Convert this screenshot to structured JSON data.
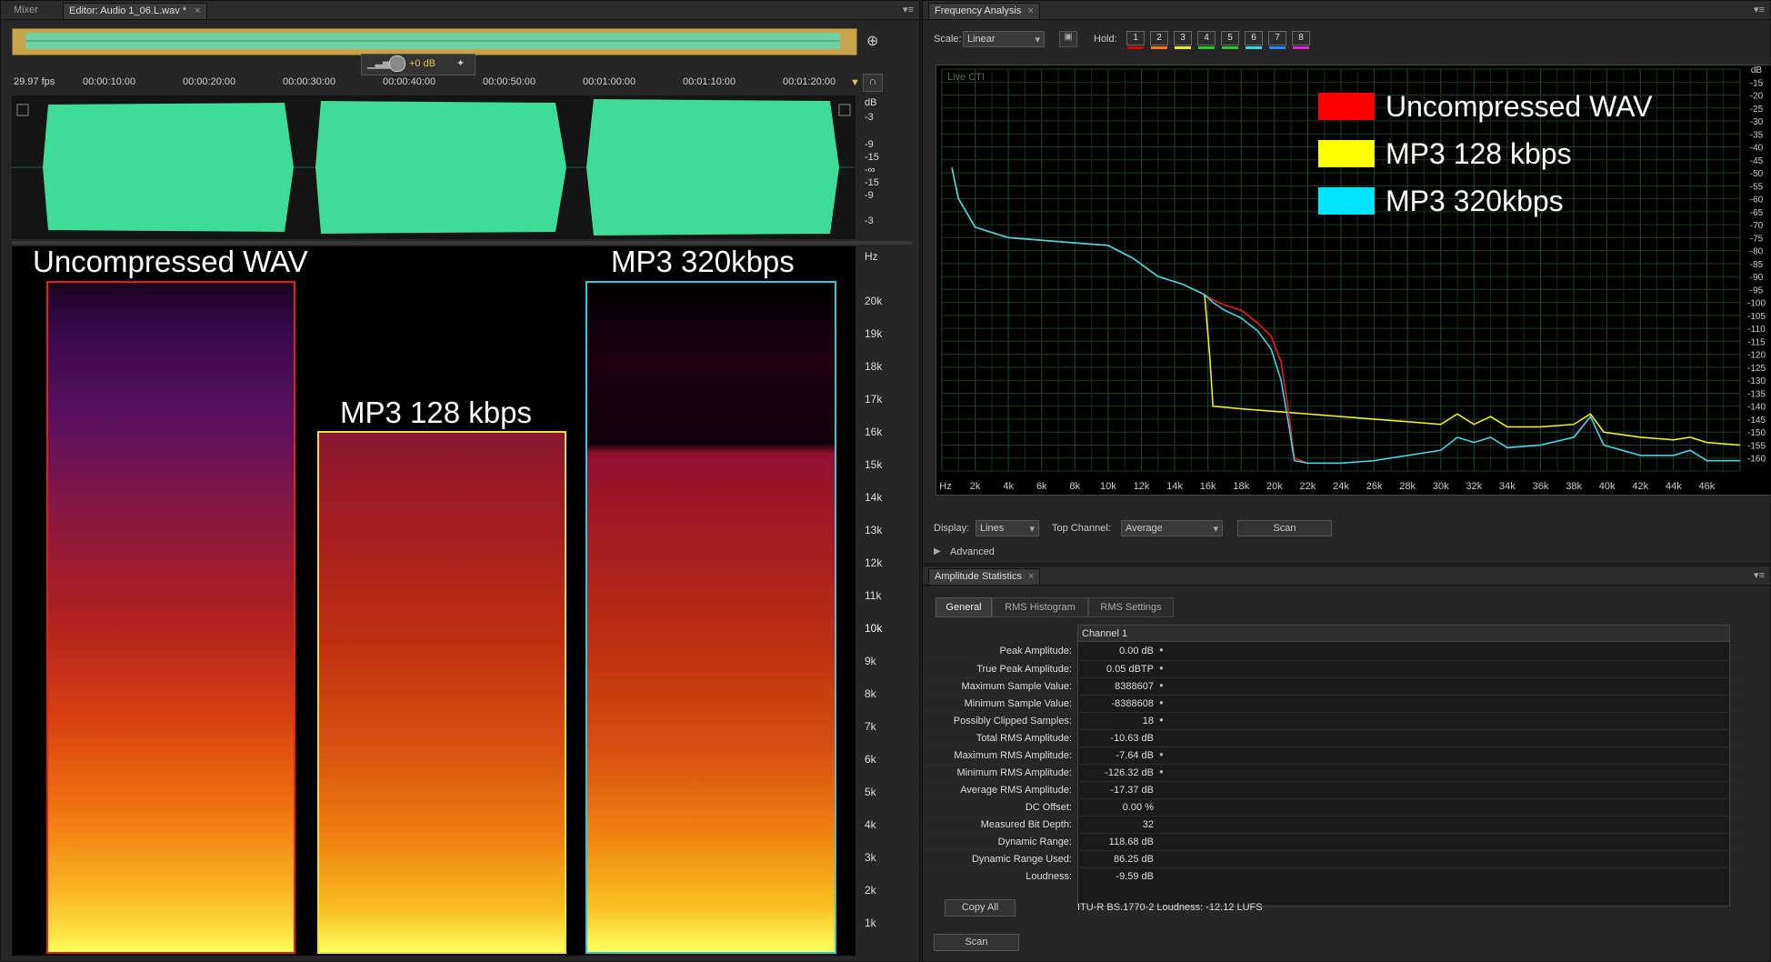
{
  "editor": {
    "tabs": {
      "mixer": "Mixer",
      "editor": "Editor: Audio 1_06.L.wav *"
    },
    "fps": "29.97 fps",
    "timecodes": [
      "00:00:10:00",
      "00:00:20:00",
      "00:00:30:00",
      "00:00:40:00",
      "00:00:50:00",
      "00:01:00:00",
      "00:01:10:00",
      "00:01:20:00"
    ],
    "hud_gain": "+0 dB",
    "db_ruler": [
      "dB",
      "-3",
      "-9",
      "-15",
      "-∞",
      "-15",
      "-9",
      "-3"
    ],
    "hz_ruler": [
      "Hz",
      "20k",
      "19k",
      "18k",
      "17k",
      "16k",
      "15k",
      "14k",
      "13k",
      "12k",
      "11k",
      "10k",
      "9k",
      "8k",
      "7k",
      "6k",
      "5k",
      "4k",
      "3k",
      "2k",
      "1k"
    ],
    "spectrogram_labels": {
      "wav": "Uncompressed WAV",
      "mp3_128": "MP3 128 kbps",
      "mp3_320": "MP3 320kbps"
    }
  },
  "frequency_analysis": {
    "title": "Frequency Analysis",
    "scale_label": "Scale:",
    "scale_value": "Linear",
    "hold_label": "Hold:",
    "hold_buttons": [
      {
        "label": "1",
        "color": "#e00000"
      },
      {
        "label": "2",
        "color": "#ff7700"
      },
      {
        "label": "3",
        "color": "#eeee00"
      },
      {
        "label": "4",
        "color": "#22cc22"
      },
      {
        "label": "5",
        "color": "#22cc22"
      },
      {
        "label": "6",
        "color": "#22ddee"
      },
      {
        "label": "7",
        "color": "#2288ff"
      },
      {
        "label": "8",
        "color": "#dd22dd"
      }
    ],
    "live_cti": "Live CTI",
    "display_label": "Display:",
    "display_value": "Lines",
    "top_channel_label": "Top Channel:",
    "top_channel_value": "Average",
    "scan_label": "Scan",
    "advanced_label": "Advanced",
    "legend": [
      {
        "name": "Uncompressed WAV",
        "color": "#ff0000"
      },
      {
        "name": "MP3 128 kbps",
        "color": "#ffff00"
      },
      {
        "name": "MP3 320kbps",
        "color": "#00e5ff"
      }
    ]
  },
  "chart_data": {
    "type": "line",
    "xlabel": "Hz",
    "ylabel": "dB",
    "x_ticks": [
      "Hz",
      "2k",
      "4k",
      "6k",
      "8k",
      "10k",
      "12k",
      "14k",
      "16k",
      "18k",
      "20k",
      "22k",
      "24k",
      "26k",
      "28k",
      "30k",
      "32k",
      "34k",
      "36k",
      "38k",
      "40k",
      "42k",
      "44k",
      "46k"
    ],
    "y_ticks": [
      "dB",
      "-15",
      "-20",
      "-25",
      "-30",
      "-35",
      "-40",
      "-45",
      "-50",
      "-55",
      "-60",
      "-65",
      "-70",
      "-75",
      "-80",
      "-85",
      "-90",
      "-95",
      "-100",
      "-105",
      "-110",
      "-115",
      "-120",
      "-125",
      "-130",
      "-135",
      "-140",
      "-145",
      "-150",
      "-155",
      "-160"
    ],
    "xlim": [
      0,
      48000
    ],
    "ylim": [
      -165,
      -10
    ],
    "grid": true,
    "legend_position": "top-right",
    "series": [
      {
        "name": "Uncompressed WAV",
        "color": "#ff1a1a",
        "points": [
          [
            600,
            -48
          ],
          [
            1000,
            -60
          ],
          [
            2000,
            -71
          ],
          [
            4000,
            -75
          ],
          [
            6000,
            -76
          ],
          [
            8000,
            -77
          ],
          [
            10000,
            -78
          ],
          [
            11500,
            -83
          ],
          [
            13000,
            -90
          ],
          [
            14500,
            -93
          ],
          [
            15800,
            -97
          ],
          [
            16300,
            -99
          ],
          [
            17000,
            -101
          ],
          [
            18000,
            -103
          ],
          [
            19000,
            -108
          ],
          [
            19800,
            -113
          ],
          [
            20400,
            -123
          ],
          [
            20800,
            -140
          ],
          [
            21200,
            -160
          ],
          [
            22000,
            -162
          ],
          [
            24000,
            -162
          ],
          [
            26000,
            -161
          ],
          [
            28000,
            -159
          ],
          [
            30000,
            -157
          ],
          [
            31000,
            -152
          ],
          [
            32000,
            -154
          ],
          [
            33000,
            -152
          ],
          [
            34000,
            -156
          ],
          [
            36000,
            -155
          ],
          [
            38000,
            -152
          ],
          [
            39000,
            -144
          ],
          [
            39800,
            -155
          ],
          [
            42000,
            -159
          ],
          [
            44000,
            -159
          ],
          [
            45000,
            -157
          ],
          [
            46000,
            -161
          ],
          [
            48000,
            -161
          ]
        ]
      },
      {
        "name": "MP3 128 kbps",
        "color": "#ffff00",
        "points": [
          [
            600,
            -48
          ],
          [
            1000,
            -60
          ],
          [
            2000,
            -71
          ],
          [
            4000,
            -75
          ],
          [
            6000,
            -76
          ],
          [
            8000,
            -77
          ],
          [
            10000,
            -78
          ],
          [
            11500,
            -83
          ],
          [
            13000,
            -90
          ],
          [
            14500,
            -93
          ],
          [
            15800,
            -97
          ],
          [
            16100,
            -120
          ],
          [
            16300,
            -140
          ],
          [
            18000,
            -141
          ],
          [
            20000,
            -142
          ],
          [
            22000,
            -143
          ],
          [
            24000,
            -144
          ],
          [
            26000,
            -145
          ],
          [
            28000,
            -146
          ],
          [
            30000,
            -147
          ],
          [
            31000,
            -143
          ],
          [
            32000,
            -147
          ],
          [
            33000,
            -144
          ],
          [
            34000,
            -148
          ],
          [
            36000,
            -148
          ],
          [
            38000,
            -147
          ],
          [
            39000,
            -143
          ],
          [
            39800,
            -150
          ],
          [
            42000,
            -152
          ],
          [
            44000,
            -153
          ],
          [
            45000,
            -152
          ],
          [
            46000,
            -154
          ],
          [
            48000,
            -155
          ]
        ]
      },
      {
        "name": "MP3 320kbps",
        "color": "#33e0f0",
        "points": [
          [
            600,
            -48
          ],
          [
            1000,
            -60
          ],
          [
            2000,
            -71
          ],
          [
            4000,
            -75
          ],
          [
            6000,
            -76
          ],
          [
            8000,
            -77
          ],
          [
            10000,
            -78
          ],
          [
            11500,
            -83
          ],
          [
            13000,
            -90
          ],
          [
            14500,
            -93
          ],
          [
            15800,
            -97
          ],
          [
            16300,
            -100
          ],
          [
            17000,
            -103
          ],
          [
            18000,
            -106
          ],
          [
            19000,
            -111
          ],
          [
            19800,
            -118
          ],
          [
            20400,
            -130
          ],
          [
            20800,
            -145
          ],
          [
            21200,
            -161
          ],
          [
            22000,
            -162
          ],
          [
            24000,
            -162
          ],
          [
            26000,
            -161
          ],
          [
            28000,
            -159
          ],
          [
            30000,
            -157
          ],
          [
            31000,
            -152
          ],
          [
            32000,
            -154
          ],
          [
            33000,
            -152
          ],
          [
            34000,
            -156
          ],
          [
            36000,
            -155
          ],
          [
            38000,
            -152
          ],
          [
            39000,
            -144
          ],
          [
            39800,
            -155
          ],
          [
            42000,
            -159
          ],
          [
            44000,
            -159
          ],
          [
            45000,
            -157
          ],
          [
            46000,
            -161
          ],
          [
            48000,
            -161
          ]
        ]
      }
    ]
  },
  "amplitude_statistics": {
    "title": "Amplitude Statistics",
    "tabs": [
      "General",
      "RMS Histogram",
      "RMS Settings"
    ],
    "channel_header": "Channel 1",
    "rows": [
      {
        "label": "Peak Amplitude:",
        "value": "0.00 dB",
        "dot": true
      },
      {
        "label": "True Peak Amplitude:",
        "value": "0.05 dBTP",
        "dot": true
      },
      {
        "label": "Maximum Sample Value:",
        "value": "8388607",
        "dot": true
      },
      {
        "label": "Minimum Sample Value:",
        "value": "-8388608",
        "dot": true
      },
      {
        "label": "Possibly Clipped Samples:",
        "value": "18",
        "dot": true
      },
      {
        "label": "Total RMS Amplitude:",
        "value": "-10.63 dB",
        "dot": false
      },
      {
        "label": "Maximum RMS Amplitude:",
        "value": "-7.64 dB",
        "dot": true
      },
      {
        "label": "Minimum RMS Amplitude:",
        "value": "-126.32 dB",
        "dot": true
      },
      {
        "label": "Average RMS Amplitude:",
        "value": "-17.37 dB",
        "dot": false
      },
      {
        "label": "DC Offset:",
        "value": "0.00 %",
        "dot": false
      },
      {
        "label": "Measured Bit Depth:",
        "value": "32",
        "dot": false
      },
      {
        "label": "Dynamic Range:",
        "value": "118.68 dB",
        "dot": false
      },
      {
        "label": "Dynamic Range Used:",
        "value": "86.25 dB",
        "dot": false
      },
      {
        "label": "Loudness:",
        "value": "-9.59 dB",
        "dot": false
      }
    ],
    "copy_all": "Copy All",
    "loudness_note": "ITU-R BS.1770-2 Loudness: -12.12 LUFS",
    "scan_label": "Scan"
  }
}
